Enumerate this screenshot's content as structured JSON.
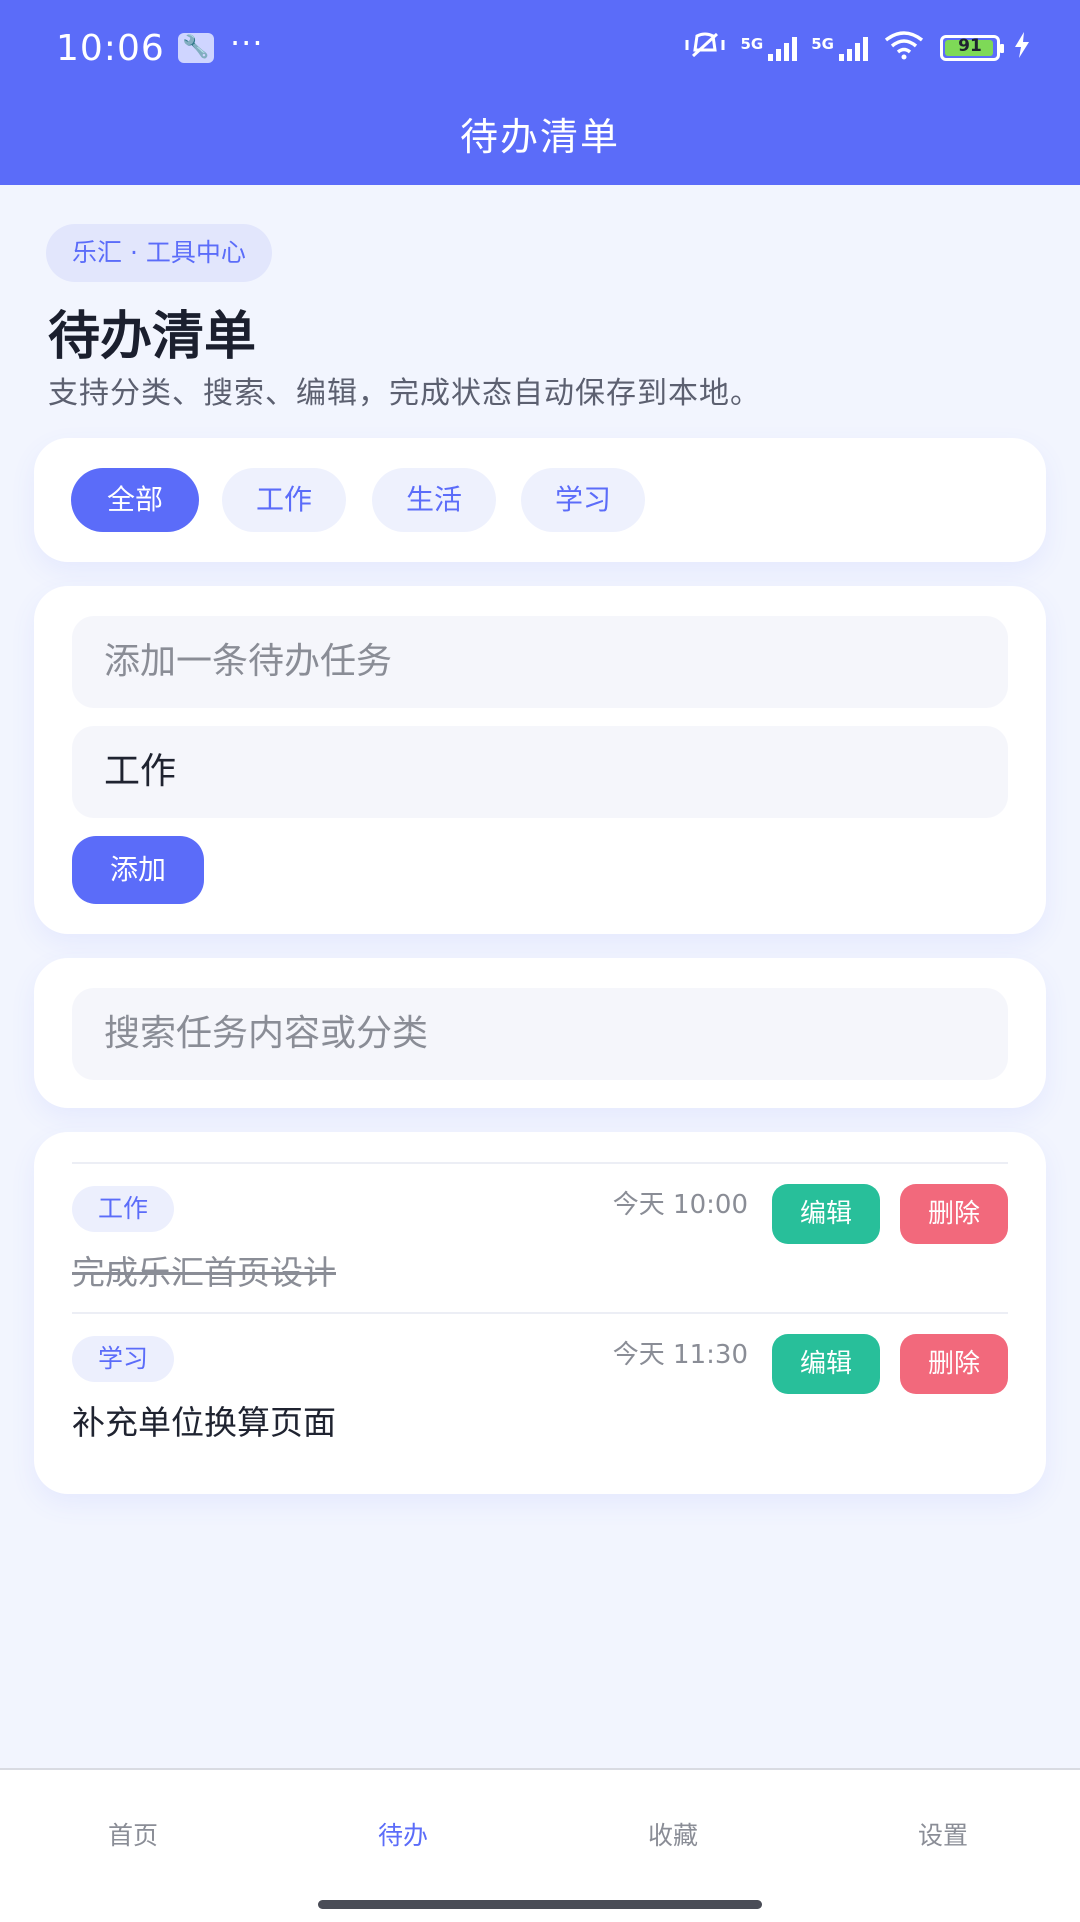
{
  "status_bar": {
    "time": "10:06",
    "more": "···",
    "signal_1": "5G",
    "signal_2": "5G",
    "battery": "91"
  },
  "header": {
    "title": "待办清单"
  },
  "intro": {
    "badge": "乐汇 · 工具中心",
    "title": "待办清单",
    "subtitle": "支持分类、搜索、编辑，完成状态自动保存到本地。"
  },
  "filter_tabs": [
    {
      "label": "全部",
      "active": true
    },
    {
      "label": "工作",
      "active": false
    },
    {
      "label": "生活",
      "active": false
    },
    {
      "label": "学习",
      "active": false
    }
  ],
  "add_form": {
    "task_placeholder": "添加一条待办任务",
    "category_value": "工作",
    "add_label": "添加"
  },
  "search": {
    "placeholder": "搜索任务内容或分类"
  },
  "tasks": [
    {
      "category": "工作",
      "time": "今天 10:00",
      "text": "完成乐汇首页设计",
      "done": true,
      "edit_label": "编辑",
      "delete_label": "删除"
    },
    {
      "category": "学习",
      "time": "今天 11:30",
      "text": "补充单位换算页面",
      "done": false,
      "edit_label": "编辑",
      "delete_label": "删除"
    }
  ],
  "bottom_nav": [
    {
      "label": "首页",
      "active": false
    },
    {
      "label": "待办",
      "active": true
    },
    {
      "label": "收藏",
      "active": false
    },
    {
      "label": "设置",
      "active": false
    }
  ],
  "colors": {
    "primary": "#5b6cf9",
    "edit": "#28bf9a",
    "delete": "#f2697c",
    "background": "#f2f5fe"
  }
}
